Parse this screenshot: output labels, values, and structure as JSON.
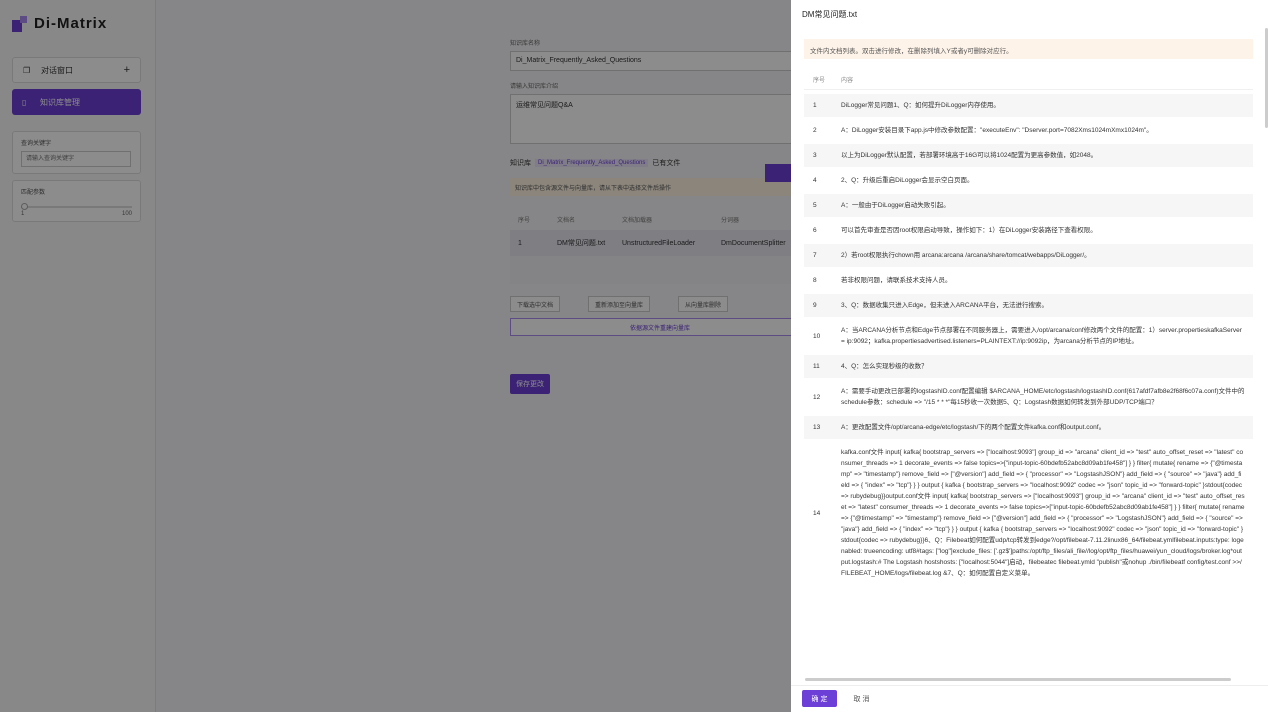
{
  "sidebar": {
    "logo_text": "Di-Matrix",
    "chat_label": "对话窗口",
    "kb_label": "知识库管理",
    "search_title": "查询关键字",
    "search_placeholder": "请输入查询关键字",
    "param_title": "匹配参数",
    "slider_min": "1",
    "slider_max": "100",
    "slider_value": 0
  },
  "main": {
    "name_label": "知识库名称",
    "name_value": "Di_Matrix_Frequently_Asked_Questions",
    "desc_label": "请输入知识库介绍",
    "desc_value": "运维常见问题Q&A",
    "kb_prefix": "知识库",
    "kb_tag": "Di_Matrix_Frequently_Asked_Questions",
    "kb_suffix": "已有文件",
    "warn_text": "知识库中包含源文件与向量库，请从下表中选择文件后操作",
    "table_headers": [
      "序号",
      "文档名",
      "文档加载器",
      "分词器"
    ],
    "table_row": [
      "1",
      "DM常见问题.txt",
      "UnstructuredFileLoader",
      "DmDocumentSplitter"
    ],
    "btn_download": "下载选中文档",
    "btn_readd": "重新添加至向量库",
    "btn_delete": "从向量库删除",
    "btn_rebuild": "依据源文件重建向量库",
    "btn_save": "保存更改"
  },
  "drawer": {
    "title": "DM常见问题.txt",
    "hint": "文件内文档列表。双击进行修改，在删除列填入Y或者y可删除对应行。",
    "col_no": "序号",
    "col_content": "内容",
    "rows": [
      {
        "n": "1",
        "t": "DiLogger常见问题1、Q：如何提升DiLogger内存使用。"
      },
      {
        "n": "2",
        "t": "A：DiLogger安装目录下app.js中修改参数配置：\"executeEnv\": \"Dserver.port=7082Xms1024mXmx1024m\"。"
      },
      {
        "n": "3",
        "t": "以上为DiLogger默认配置，若部署环境高于16G可以将1024配置为更高参数值，如2048。"
      },
      {
        "n": "4",
        "t": "2、Q：升级后重启DiLogger会显示空白页面。"
      },
      {
        "n": "5",
        "t": "A：一般由于DiLogger启动失败引起。"
      },
      {
        "n": "6",
        "t": "可以首先审查是否因root权限启动导致，操作如下：1）在DiLogger安装路径下查看权限。"
      },
      {
        "n": "7",
        "t": "2）若root权限执行chown用 arcana:arcana /arcana/share/tomcat/webapps/DiLogger/。"
      },
      {
        "n": "8",
        "t": "若非权限问题，请联系技术支持人员。"
      },
      {
        "n": "9",
        "t": "3、Q：数据收集只进入Edge，但未进入ARCANA平台，无法进行搜索。"
      },
      {
        "n": "10",
        "t": "A：当ARCANA分析节点和Edge节点部署在不同服务器上，需要进入/opt/arcana/conf修改两个文件的配置：1）server.propertieskafkaServer = ip:9092；kafka.propertiesadvertised.listeners=PLAINTEXT://ip:9092ip，为arcana分析节点的IP地址。"
      },
      {
        "n": "11",
        "t": "4、Q：怎么实现秒级的收数？"
      },
      {
        "n": "12",
        "t": "A：需要手动更改已部署的logstashID.conf配置编辑 $ARCANA_HOME/etc/logstash/logstashID.conf(617afdf7afb8e2f68f6c07a.conf)文件中的schedule参数：schedule => \"/15 * * *\"每15秒收一次数据5、Q：Logstash数据如何转发到外部UDP/TCP端口？"
      },
      {
        "n": "13",
        "t": "A：更改配置文件/opt/arcana-edge/etc/logstash/下的两个配置文件kafka.conf和output.conf。"
      },
      {
        "n": "14",
        "t": "kafka.conf文件 input{ kafka{ bootstrap_servers => [\"localhost:9093\"] group_id => \"arcana\" client_id => \"test\" auto_offset_reset => \"latest\" consumer_threads => 1 decorate_events => false topics=>[\"input-topic-60bdefb52abc8d09ab1fe458\"] } } filter{ mutate{ rename => {\"@timestamp\" => \"timestamp\"} remove_field => [\"@version\"] add_field => { \"processor\" => \"LogstashJSON\"} add_field => { \"source\" => \"java\"} add_field => { \"index\" => \"tcp\"} } } output { kafka { bootstrap_servers => \"localhost:9092\" codec => \"json\" topic_id => \"forward-topic\" }stdout{codec => rubydebug}}output.conf文件 input{ kafka{ bootstrap_servers => [\"localhost:9093\"] group_id => \"arcana\" client_id => \"test\" auto_offset_reset => \"latest\" consumer_threads => 1 decorate_events => false topics=>[\"input-topic-60bdefb52abc8d09ab1fe458\"] } } filter{ mutate{ rename => {\"@timestamp\" => \"timestamp\"} remove_field => [\"@version\"] add_field => { \"processor\" => \"LogstashJSON\"} add_field => { \"source\" => \"java\"} add_field => { \"index\" => \"tcp\"} } } output { kafka { bootstrap_servers => \"localhost:9092\" codec => \"json\" topic_id => \"forward-topic\" }stdout{codec => rubydebug}}6、Q：Filebeat如何配置udp/tcp转发到edge?/opt/filebeat-7.11.2linux86_64/filebeat.ymlfilebeat.inputs:type: logenabled: trueencoding: utf8#tags: [\"log\"]exclude_files: ['.gz$']paths:/opt/ftp_files/ali_file//log/opt/ftp_files/huawei/yun_cloud/logs/broker.log*output.logstash:# The Logstash hostshosts: [\"localhost:5044\"]启动，filebeatec filebeat.ymld \"publish\"或nohup ./bin/filebeatf config/test.conf >>/FILEBEAT_HOME/logs/filebeat.log &7、Q：如何配置自定义菜单。"
      }
    ],
    "ok_label": "确 定",
    "cancel_label": "取 消"
  }
}
